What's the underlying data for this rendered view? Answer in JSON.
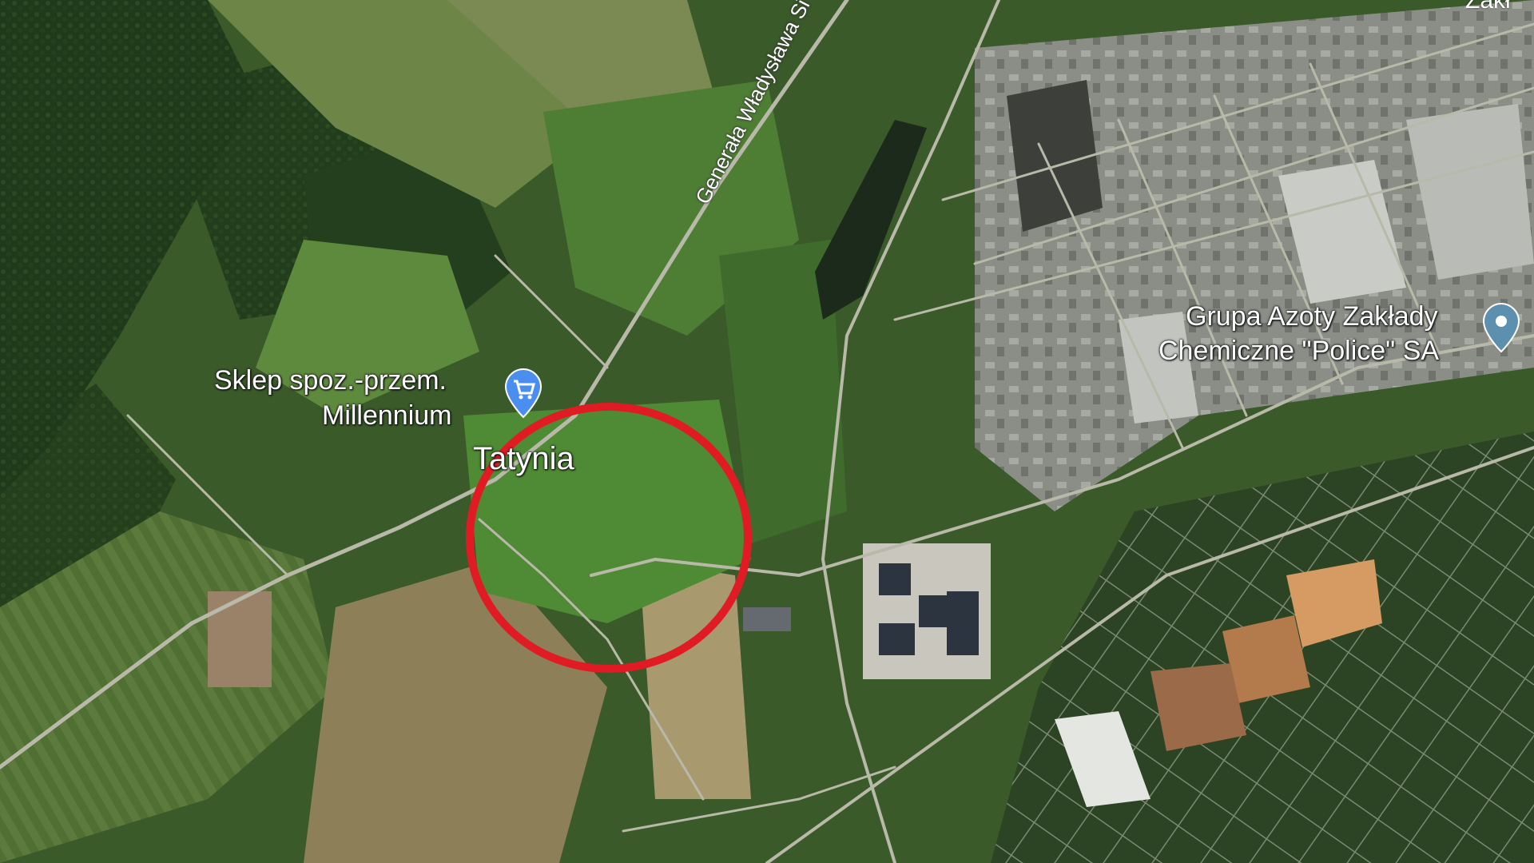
{
  "map": {
    "view": "satellite",
    "highlight_color": "#e01b24"
  },
  "labels": {
    "road": "Generała Władysława Si",
    "shop_line1": "Sklep spoz.-przem.",
    "shop_line2": "Millennium",
    "village": "Tatynia",
    "plant_line1": "Grupa Azoty Zakłady",
    "plant_line2": "Chemiczne \"Police\" SA",
    "clipped_top_right": "Zakł"
  },
  "icons": {
    "shop_pin": "shopping-cart-pin-icon",
    "plant_pin": "place-pin-icon",
    "shop_pin_color": "#4a8ff0",
    "plant_pin_color": "#5d8fae"
  }
}
